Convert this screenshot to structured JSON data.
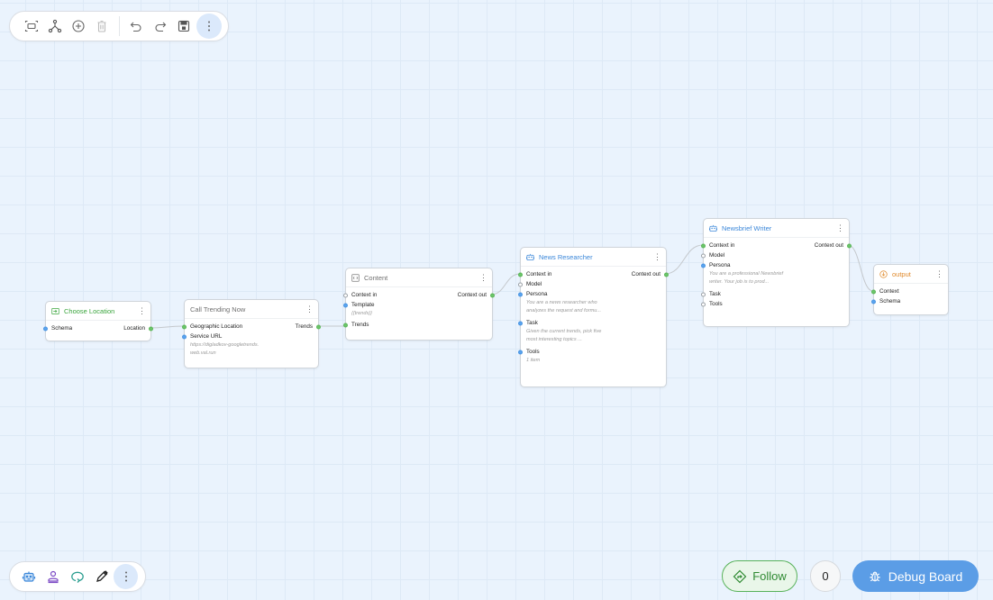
{
  "top_toolbar": {
    "items": [
      {
        "name": "fit-view",
        "icon": "fit-view-icon"
      },
      {
        "name": "layout",
        "icon": "graph-layout-icon"
      },
      {
        "name": "add-node",
        "icon": "plus-circle-icon"
      },
      {
        "name": "delete",
        "icon": "trash-icon"
      },
      {
        "name": "undo",
        "icon": "undo-icon"
      },
      {
        "name": "redo",
        "icon": "redo-icon"
      },
      {
        "name": "save",
        "icon": "save-icon"
      },
      {
        "name": "more",
        "icon": "more-vertical-icon"
      }
    ]
  },
  "bottom_toolbar": {
    "items": [
      {
        "name": "agent",
        "icon": "robot-icon"
      },
      {
        "name": "persona",
        "icon": "user-icon"
      },
      {
        "name": "loop",
        "icon": "loop-icon"
      },
      {
        "name": "pen",
        "icon": "pen-icon"
      },
      {
        "name": "more",
        "icon": "more-vertical-icon"
      }
    ]
  },
  "nodes": {
    "choose_location": {
      "title": "Choose Location",
      "title_color": "#3aa53d",
      "icon": "input-icon",
      "ports": {
        "schema": "Schema",
        "location": "Location"
      }
    },
    "call_trending": {
      "title": "Call Trending Now",
      "title_color": "#6f6f6f",
      "ports": {
        "geo": "Geographic Location",
        "trends": "Trends",
        "service_url": "Service URL"
      },
      "service_url_value": "https://digladkov-googletrends.web.val.run"
    },
    "content": {
      "title": "Content",
      "title_color": "#6f6f6f",
      "icon": "code-icon",
      "ports": {
        "context_in": "Context in",
        "context_out": "Context out",
        "template": "Template",
        "trends": "Trends"
      },
      "template_value": "{{trends}}"
    },
    "news_researcher": {
      "title": "News Researcher",
      "title_color": "#3b87d9",
      "icon": "robot-icon",
      "ports": {
        "context_in": "Context in",
        "context_out": "Context out",
        "model": "Model",
        "persona": "Persona",
        "task": "Task",
        "tools": "Tools"
      },
      "persona_value": "You are a news researcher who analyzes the request and formu...",
      "task_value": "Given the current trends, pick five most interesting topics ...",
      "tools_value": "1 item"
    },
    "newsbrief_writer": {
      "title": "Newsbrief Writer",
      "title_color": "#3b87d9",
      "icon": "robot-icon",
      "ports": {
        "context_in": "Context in",
        "context_out": "Context out",
        "model": "Model",
        "persona": "Persona",
        "task": "Task",
        "tools": "Tools"
      },
      "persona_value": "You are a professional Newsbrief writer. Your job is to prod..."
    },
    "output": {
      "title": "output",
      "title_color": "#e08a2c",
      "icon": "output-icon",
      "ports": {
        "context": "Context",
        "schema": "Schema"
      }
    }
  },
  "footer": {
    "follow_label": "Follow",
    "count": "0",
    "debug_label": "Debug Board"
  }
}
